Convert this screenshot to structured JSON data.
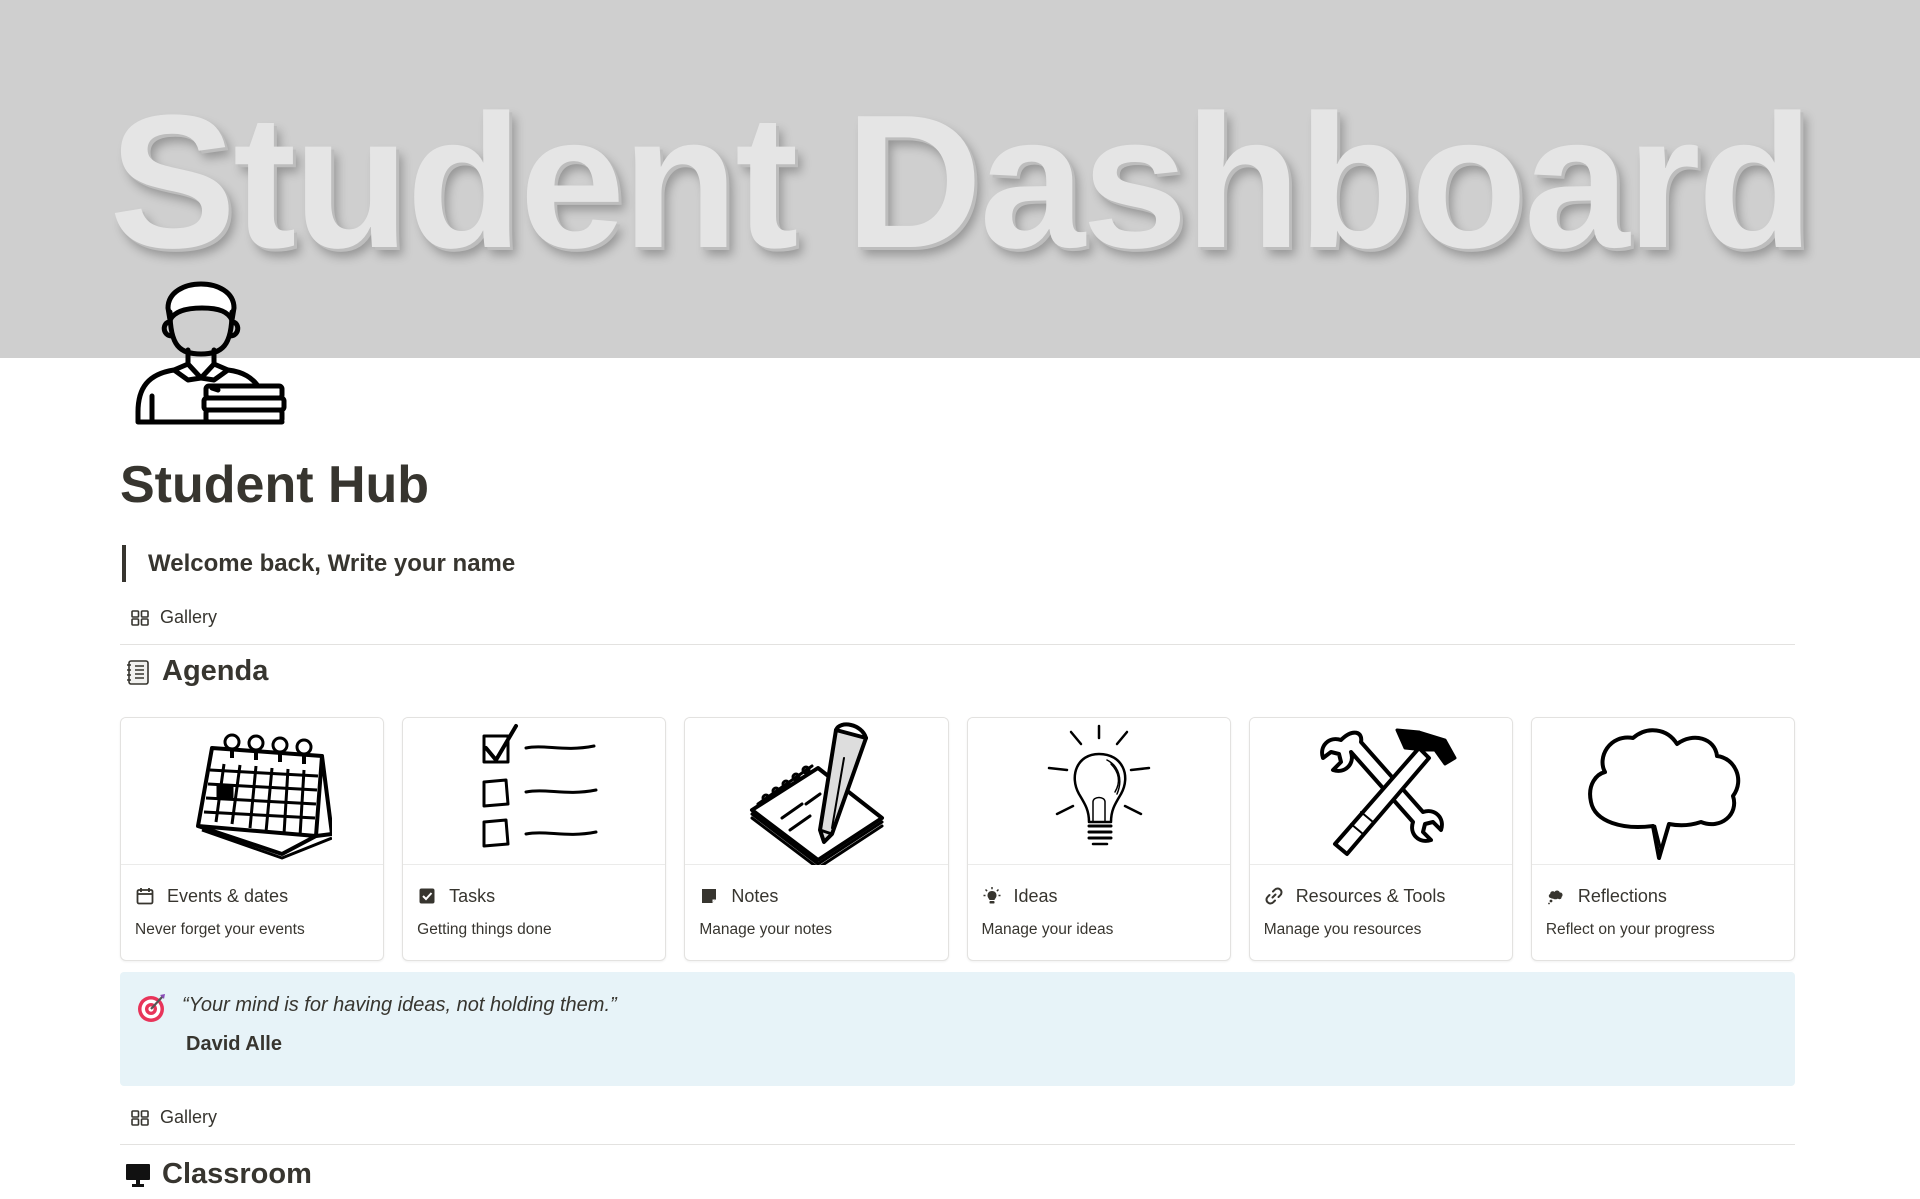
{
  "cover": {
    "title": "Student Dashboard"
  },
  "page": {
    "icon": "student-with-books-icon",
    "title": "Student Hub"
  },
  "welcome": "Welcome back, Write your name",
  "agenda": {
    "view_label": "Gallery",
    "heading": "Agenda",
    "cards": [
      {
        "title": "Events & dates",
        "description": "Never forget your events",
        "icon": "calendar-icon",
        "image": "desk-calendar-illustration"
      },
      {
        "title": "Tasks",
        "description": "Getting things done",
        "icon": "checkbox-icon",
        "image": "checklist-illustration"
      },
      {
        "title": "Notes",
        "description": "Manage your notes",
        "icon": "sticky-note-icon",
        "image": "notepad-pencil-illustration"
      },
      {
        "title": "Ideas",
        "description": "Manage your ideas",
        "icon": "lightbulb-icon",
        "image": "lightbulb-illustration"
      },
      {
        "title": "Resources & Tools",
        "description": "Manage you resources",
        "icon": "link-icon",
        "image": "wrench-hammer-illustration"
      },
      {
        "title": "Reflections",
        "description": "Reflect on your progress",
        "icon": "thought-bubble-icon",
        "image": "speech-bubble-illustration"
      }
    ]
  },
  "callout": {
    "icon": "target-icon",
    "quote": "“Your mind is for having ideas, not holding them.”",
    "author": "David Alle"
  },
  "classroom": {
    "view_label": "Gallery",
    "heading": "Classroom"
  },
  "colors": {
    "text": "#37352f",
    "cover": "#cfcfcf",
    "callout_bg": "#e7f3f8",
    "divider": "#e3e2e0"
  }
}
